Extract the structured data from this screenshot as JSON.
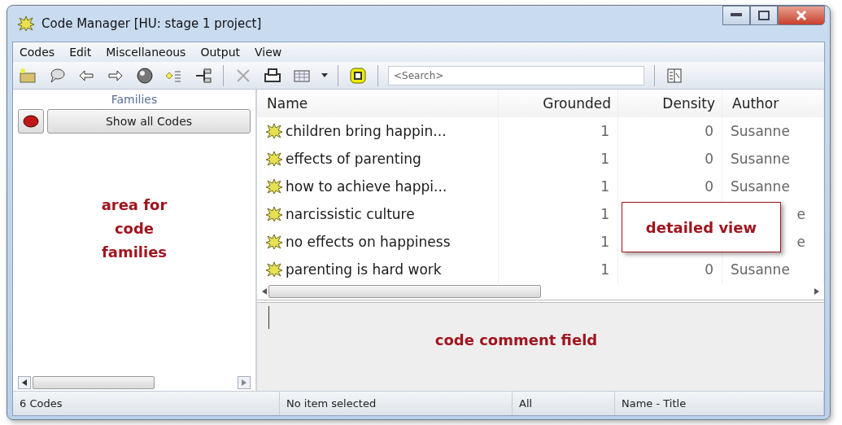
{
  "window": {
    "title": "Code Manager [HU: stage 1 project]"
  },
  "menu": [
    "Codes",
    "Edit",
    "Miscellaneous",
    "Output",
    "View"
  ],
  "search": {
    "placeholder": "<Search>"
  },
  "families": {
    "title": "Families",
    "button": "Show all Codes",
    "annotation": "area for code families"
  },
  "table": {
    "columns": [
      "Name",
      "Grounded",
      "Density",
      "Author"
    ],
    "rows": [
      {
        "name": "children bring happin...",
        "grounded": "1",
        "density": "0",
        "author": "Susanne"
      },
      {
        "name": "effects of parenting",
        "grounded": "1",
        "density": "0",
        "author": "Susanne"
      },
      {
        "name": "how to achieve happi...",
        "grounded": "1",
        "density": "0",
        "author": "Susanne"
      },
      {
        "name": "narcissistic culture",
        "grounded": "1",
        "author": "e"
      },
      {
        "name": "no effects on happiness",
        "grounded": "1",
        "author": "e"
      },
      {
        "name": "parenting is hard work",
        "grounded": "1",
        "density": "0",
        "author": "Susanne"
      }
    ],
    "callout": "detailed view"
  },
  "comment": {
    "annotation": "code comment field"
  },
  "status_bar": [
    "6 Codes",
    "No item selected",
    "All",
    "Name - Title"
  ]
}
